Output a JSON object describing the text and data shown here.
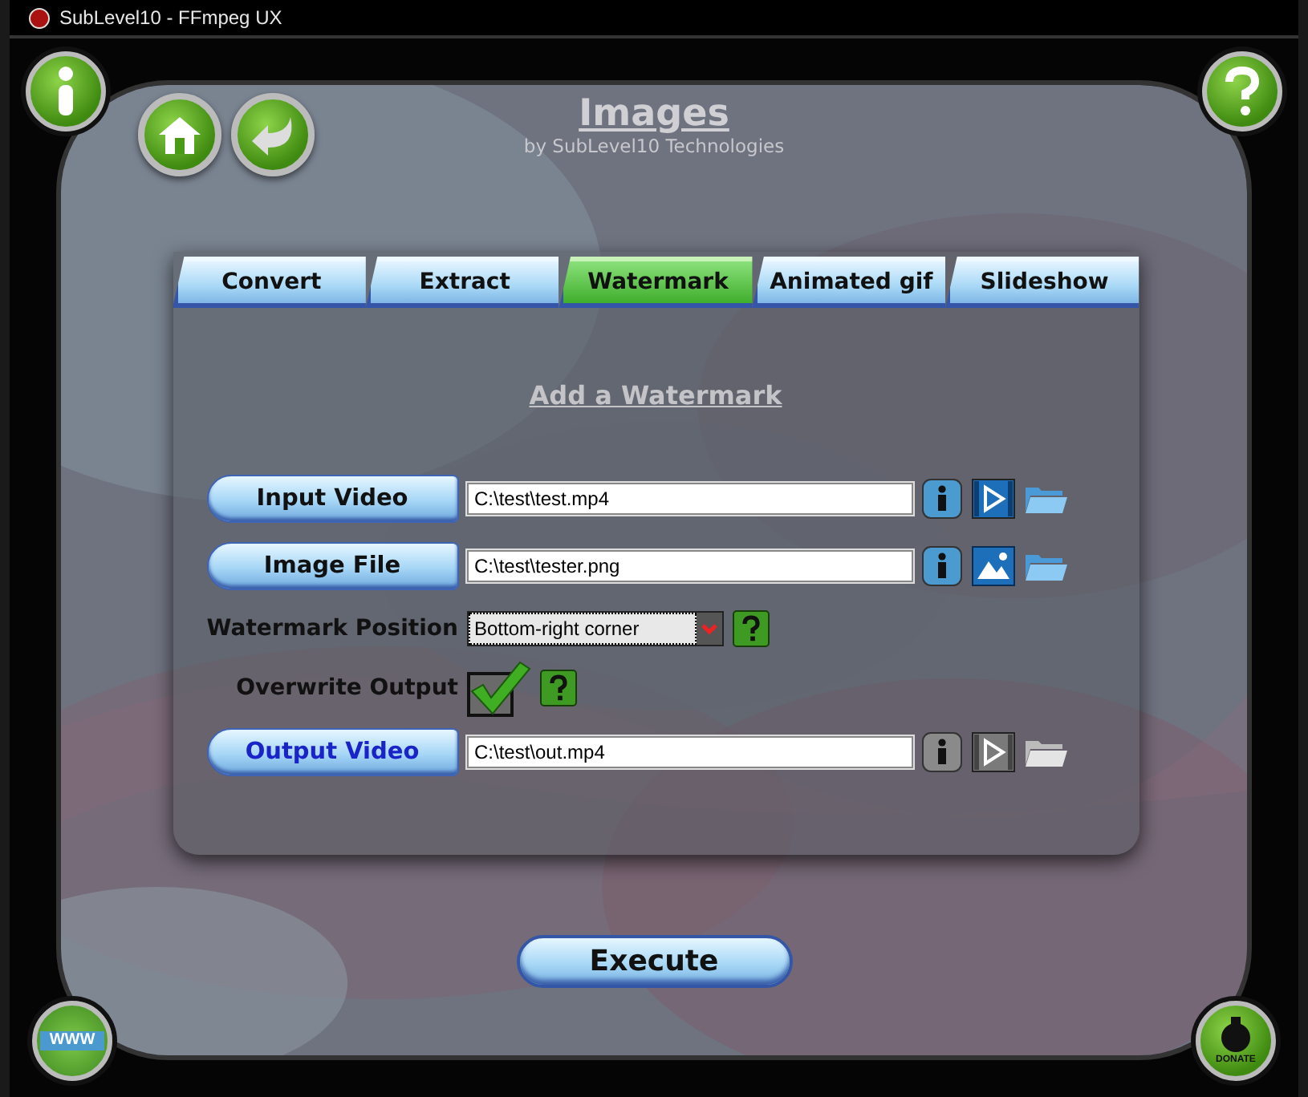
{
  "window": {
    "title": "SubLevel10 - FFmpeg UX"
  },
  "header": {
    "title": "Images",
    "subtitle": "by SubLevel10 Technologies"
  },
  "tabs": [
    {
      "label": "Convert",
      "selected": false
    },
    {
      "label": "Extract",
      "selected": false
    },
    {
      "label": "Watermark",
      "selected": true
    },
    {
      "label": "Animated gif",
      "selected": false
    },
    {
      "label": "Slideshow",
      "selected": false
    }
  ],
  "section_title": "Add a Watermark",
  "rows": [
    {
      "kind": "file",
      "label": "Input Video",
      "value": "C:\\test\\test.mp4",
      "image_preview": false,
      "active": true
    },
    {
      "kind": "file",
      "label": "Image File",
      "value": "C:\\test\\tester.png",
      "image_preview": true,
      "active": true
    },
    {
      "kind": "select",
      "label": "Watermark Position",
      "value": "Bottom-right corner"
    },
    {
      "kind": "checkbox",
      "label": "Overwrite Output",
      "checked": true
    },
    {
      "kind": "file",
      "label": "Output Video",
      "value": "C:\\test\\out.mp4",
      "image_preview": false,
      "active": false
    }
  ],
  "execute": "Execute",
  "corner_buttons": {
    "web_label": "WWW",
    "donate_label": "DONATE"
  }
}
